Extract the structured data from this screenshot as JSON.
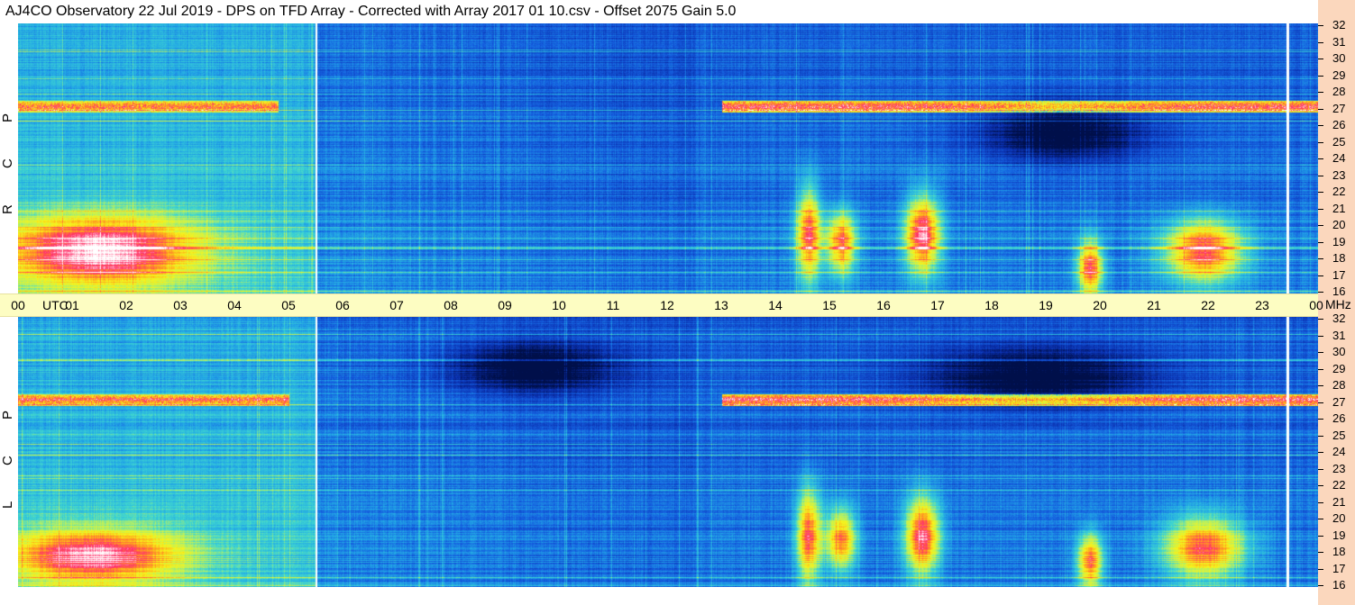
{
  "title": "AJ4CO Observatory  22 Jul 2019  -  DPS on TFD Array  -  Corrected with Array 2017 01 10.csv  -  Offset 2075  Gain 5.0",
  "colors": {
    "axis_band": "#fdfdc2",
    "right_strip": "#fbd7bd",
    "colormap": [
      "#000f4a",
      "#0a2fae",
      "#1560e0",
      "#22a7e6",
      "#3fd6d0",
      "#b8f060",
      "#f8f41a",
      "#ff9a20",
      "#ff2f6a",
      "#ffffff"
    ]
  },
  "chart_data": [
    {
      "type": "heatmap",
      "panel": "top",
      "ylabel": "R C P",
      "x_unit": "UTC",
      "y_unit": "MHz",
      "x_tick_labels": [
        "00",
        "01",
        "02",
        "03",
        "04",
        "05",
        "06",
        "07",
        "08",
        "09",
        "10",
        "11",
        "12",
        "13",
        "14",
        "15",
        "16",
        "17",
        "18",
        "19",
        "20",
        "21",
        "22",
        "23",
        "00"
      ],
      "y_tick_labels": [
        "16",
        "17",
        "18",
        "19",
        "20",
        "21",
        "22",
        "23",
        "24",
        "25",
        "26",
        "27",
        "28",
        "29",
        "30",
        "31",
        "32"
      ],
      "xlim_hours": [
        0,
        24
      ],
      "ylim_mhz": [
        16,
        32
      ],
      "features": [
        {
          "kind": "marker_line",
          "utc_hour": 5.5,
          "color": "#ffffff"
        },
        {
          "kind": "marker_line",
          "utc_hour": 23.45,
          "color": "#ffffff"
        },
        {
          "kind": "interference_band",
          "mhz": 27.1,
          "utc_start": 0,
          "utc_end": 4.8,
          "intensity": 0.85
        },
        {
          "kind": "interference_band",
          "mhz": 27.1,
          "utc_start": 13.0,
          "utc_end": 24,
          "intensity": 0.9
        },
        {
          "kind": "emission_blob",
          "utc_hour": 1.5,
          "mhz": 18.5,
          "utc_width": 4.0,
          "mhz_width": 4.5,
          "intensity": 0.62
        },
        {
          "kind": "emission_blob",
          "utc_hour": 14.6,
          "mhz": 19.5,
          "utc_width": 0.5,
          "mhz_width": 6.0,
          "intensity": 0.6
        },
        {
          "kind": "emission_blob",
          "utc_hour": 15.2,
          "mhz": 19.0,
          "utc_width": 0.6,
          "mhz_width": 4.0,
          "intensity": 0.55
        },
        {
          "kind": "emission_blob",
          "utc_hour": 16.7,
          "mhz": 19.5,
          "utc_width": 0.7,
          "mhz_width": 5.0,
          "intensity": 0.68
        },
        {
          "kind": "emission_blob",
          "utc_hour": 19.8,
          "mhz": 17.5,
          "utc_width": 0.5,
          "mhz_width": 3.5,
          "intensity": 0.6
        },
        {
          "kind": "emission_blob",
          "utc_hour": 21.9,
          "mhz": 18.5,
          "utc_width": 1.6,
          "mhz_width": 4.0,
          "intensity": 0.62
        },
        {
          "kind": "quiet_region",
          "utc_hour": 19.3,
          "mhz": 25.5,
          "utc_width": 3.0,
          "mhz_width": 3.5
        }
      ]
    },
    {
      "type": "heatmap",
      "panel": "bottom",
      "ylabel": "L C P",
      "x_unit": "UTC",
      "y_unit": "MHz",
      "x_tick_labels": [
        "00",
        "01",
        "02",
        "03",
        "04",
        "05",
        "06",
        "07",
        "08",
        "09",
        "10",
        "11",
        "12",
        "13",
        "14",
        "15",
        "16",
        "17",
        "18",
        "19",
        "20",
        "21",
        "22",
        "23",
        "00"
      ],
      "y_tick_labels": [
        "16",
        "17",
        "18",
        "19",
        "20",
        "21",
        "22",
        "23",
        "24",
        "25",
        "26",
        "27",
        "28",
        "29",
        "30",
        "31",
        "32"
      ],
      "xlim_hours": [
        0,
        24
      ],
      "ylim_mhz": [
        16,
        32
      ],
      "features": [
        {
          "kind": "marker_line",
          "utc_hour": 5.5,
          "color": "#ffffff"
        },
        {
          "kind": "marker_line",
          "utc_hour": 23.45,
          "color": "#ffffff"
        },
        {
          "kind": "interference_band",
          "mhz": 27.1,
          "utc_start": 0,
          "utc_end": 5.0,
          "intensity": 0.85
        },
        {
          "kind": "interference_band",
          "mhz": 27.1,
          "utc_start": 13.0,
          "utc_end": 24,
          "intensity": 0.9
        },
        {
          "kind": "emission_blob",
          "utc_hour": 1.4,
          "mhz": 17.8,
          "utc_width": 3.5,
          "mhz_width": 3.5,
          "intensity": 0.58
        },
        {
          "kind": "emission_blob",
          "utc_hour": 14.6,
          "mhz": 19.0,
          "utc_width": 0.5,
          "mhz_width": 6.0,
          "intensity": 0.6
        },
        {
          "kind": "emission_blob",
          "utc_hour": 15.2,
          "mhz": 18.8,
          "utc_width": 0.6,
          "mhz_width": 4.0,
          "intensity": 0.55
        },
        {
          "kind": "emission_blob",
          "utc_hour": 16.7,
          "mhz": 19.0,
          "utc_width": 0.7,
          "mhz_width": 5.0,
          "intensity": 0.66
        },
        {
          "kind": "emission_blob",
          "utc_hour": 19.8,
          "mhz": 17.5,
          "utc_width": 0.5,
          "mhz_width": 3.5,
          "intensity": 0.58
        },
        {
          "kind": "emission_blob",
          "utc_hour": 21.9,
          "mhz": 18.3,
          "utc_width": 1.6,
          "mhz_width": 4.0,
          "intensity": 0.6
        },
        {
          "kind": "quiet_region",
          "utc_hour": 18.8,
          "mhz": 28.5,
          "utc_width": 4.0,
          "mhz_width": 3.5
        },
        {
          "kind": "quiet_region",
          "utc_hour": 9.5,
          "mhz": 29.0,
          "utc_width": 3.0,
          "mhz_width": 3.0
        }
      ]
    }
  ]
}
